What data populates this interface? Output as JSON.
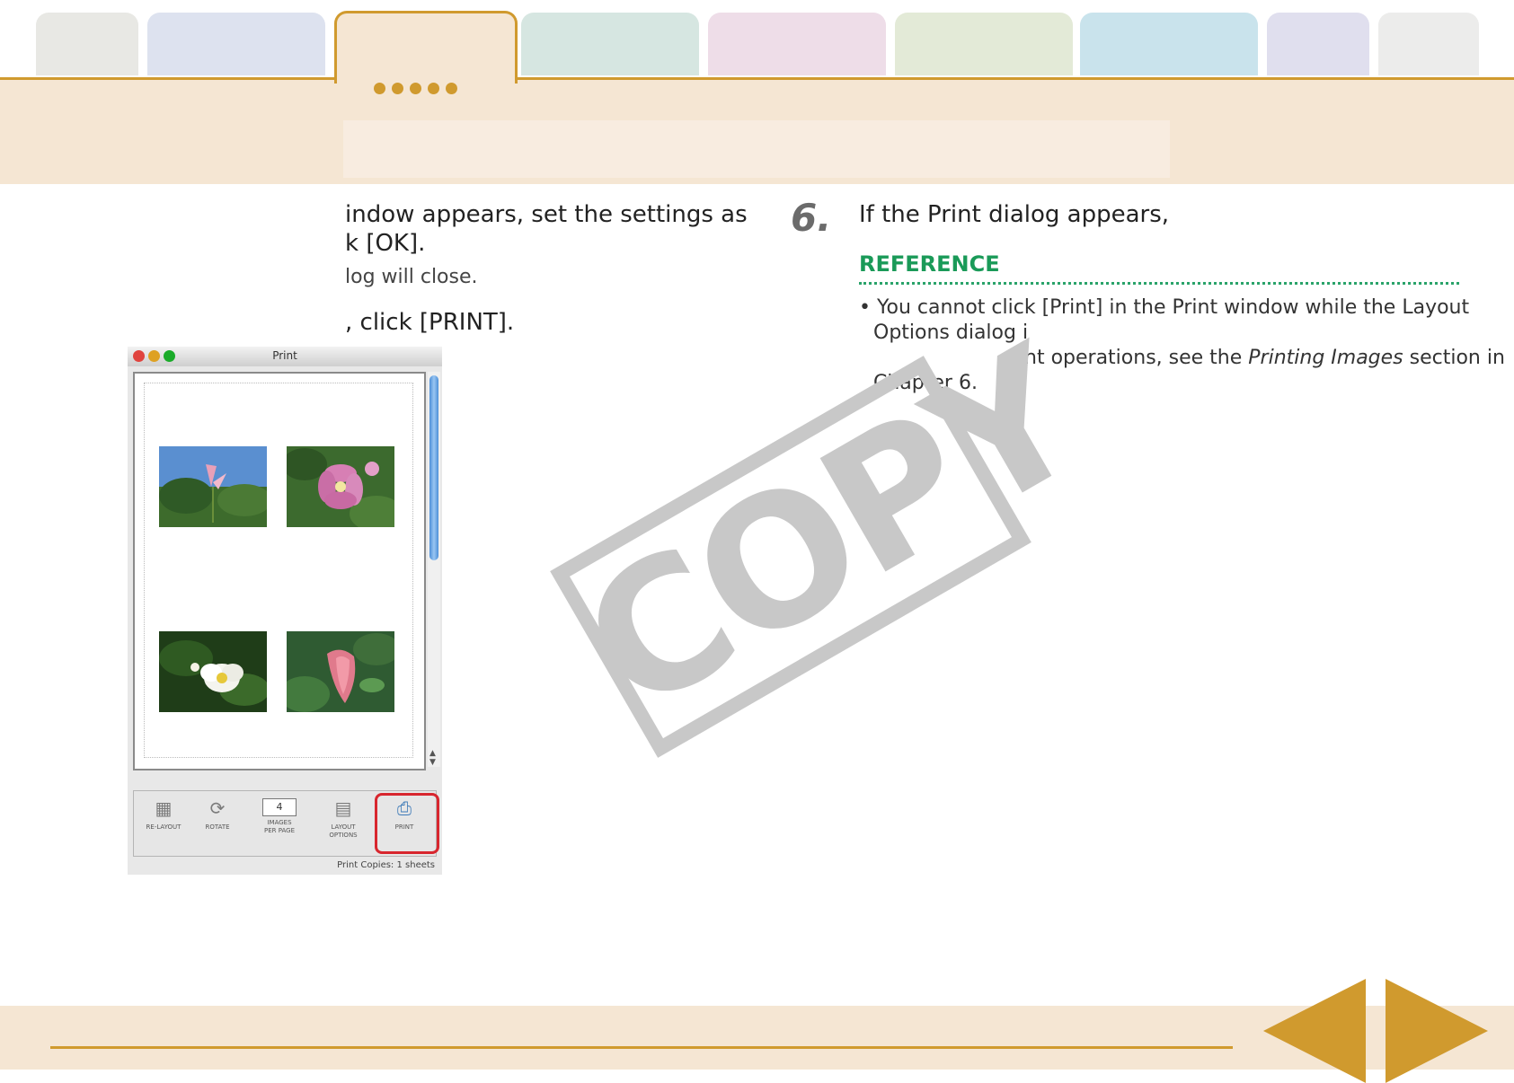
{
  "left_column": {
    "line1": "indow appears, set the settings as",
    "line2": " k [OK].",
    "note": "log will close.",
    "line3": ", click [PRINT]."
  },
  "step6": {
    "number": "6.",
    "text": "If the Print dialog appears,",
    "reference_heading": "REFERENCE",
    "reference_lines": [
      "• You cannot click [Print] in the Print window while the Layout",
      "Options dialog i",
      "nt operations, see the ",
      "Printing Images",
      " section in",
      "Chapter 6."
    ]
  },
  "window": {
    "title": "Print",
    "toolbar": {
      "relayout": "RE-LAYOUT",
      "rotate": "ROTATE",
      "images_per_page_line1": "IMAGES",
      "images_per_page_line2": "PER PAGE",
      "images_per_page_value": "4",
      "layout_options_line1": "LAYOUT",
      "layout_options_line2": "OPTIONS",
      "print": "PRINT"
    },
    "status": "Print Copies: 1 sheets"
  },
  "watermark": "COPY",
  "colors": {
    "accent": "#d09a2e",
    "header_band": "#f5e6d3",
    "reference_green": "#1a9a58",
    "highlight_red": "#d8262e"
  }
}
